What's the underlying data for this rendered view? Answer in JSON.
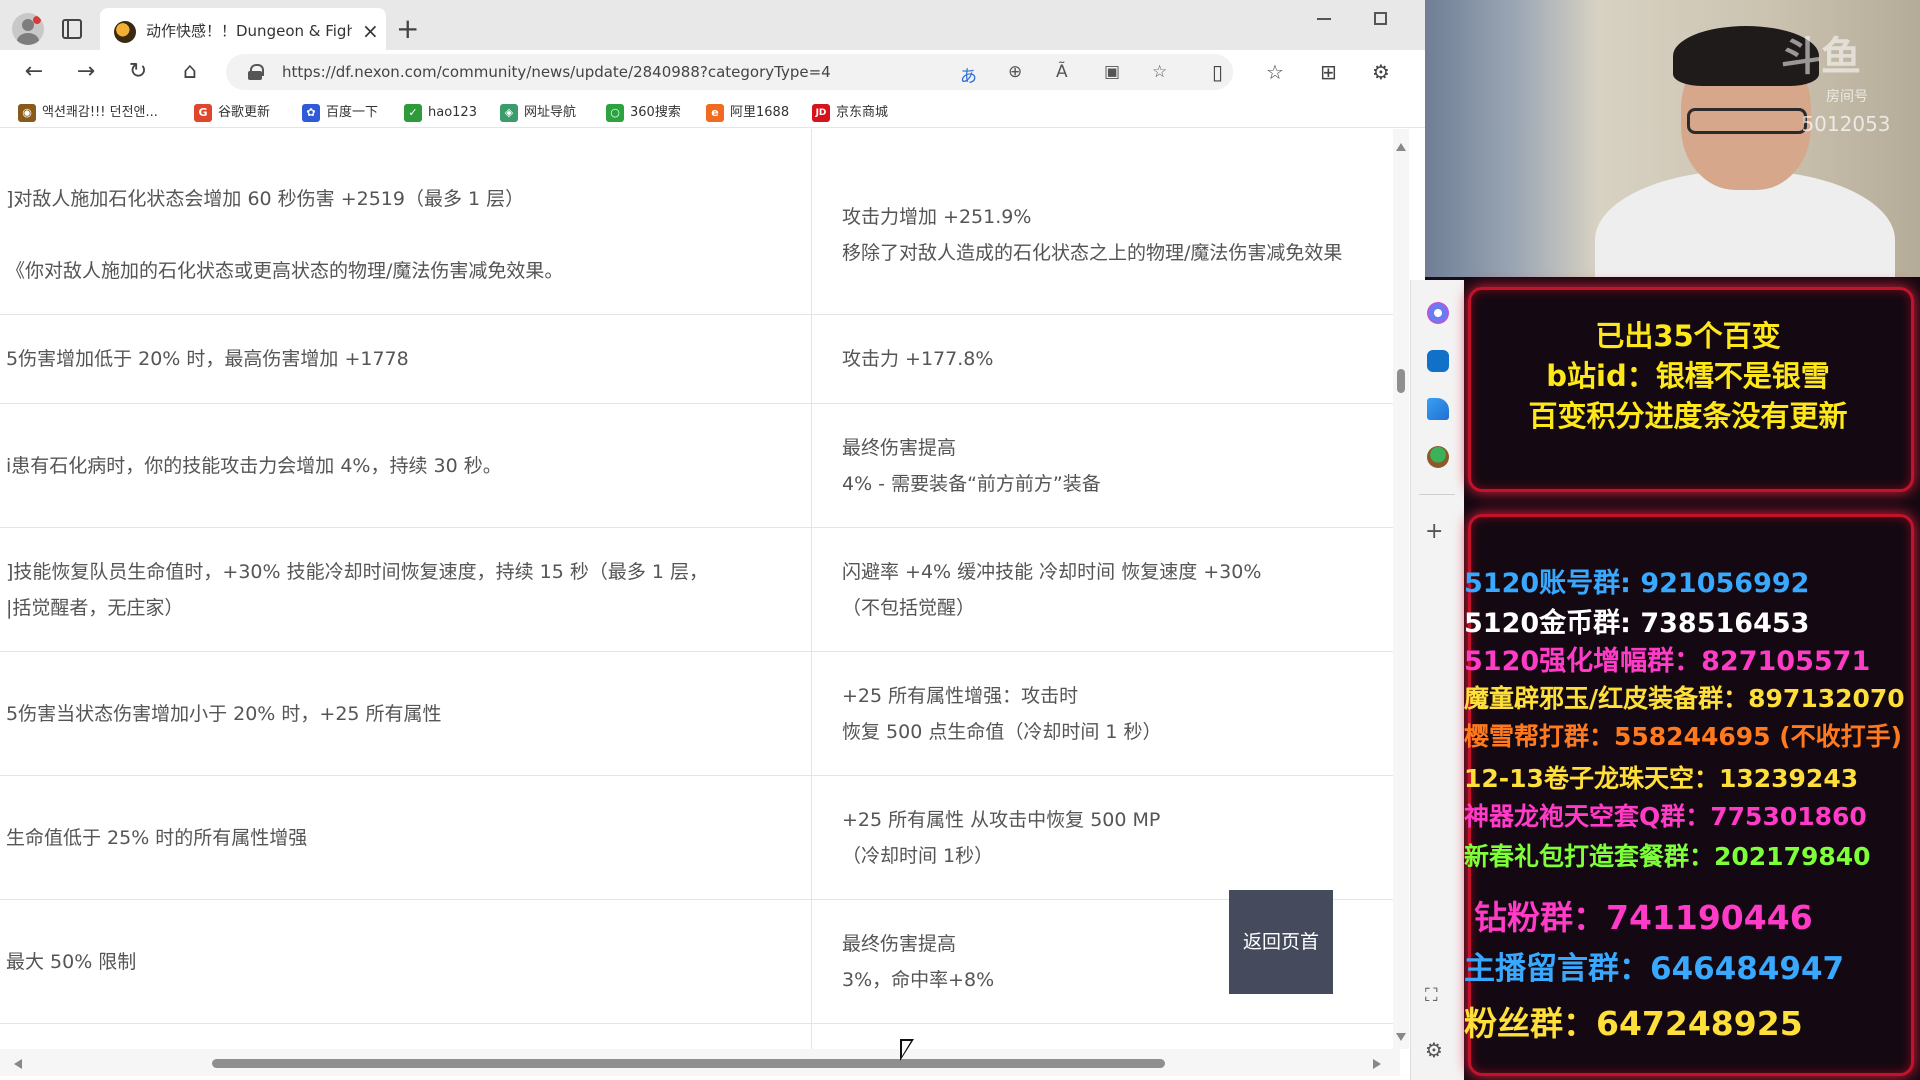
{
  "browser": {
    "tab_title": "动作快感！！Dungeon & Fighter",
    "tab_close": "×",
    "newtab": "+",
    "url": "https://df.nexon.com/community/news/update/2840988?categoryType=4",
    "nav": {
      "back": "←",
      "forward": "→",
      "reload": "↻",
      "home": "⌂"
    },
    "addr_icons": {
      "translate": "あ",
      "zoom": "⊕",
      "read_aloud": "Ã",
      "immersive": "▣",
      "favorite": "☆"
    },
    "right_icons": {
      "split": "▯",
      "favorites": "☆",
      "collections": "⊞",
      "extensions": "⚙"
    },
    "bookmarks": [
      {
        "label": "액션쾌감!!! 던전앤...",
        "icon_color": "#8a5a1a",
        "icon": "◉"
      },
      {
        "label": "谷歌更新",
        "icon_color": "#e0462c",
        "icon": "G"
      },
      {
        "label": "百度一下",
        "icon_color": "#2f5bd8",
        "icon": "✿"
      },
      {
        "label": "hao123",
        "icon_color": "#2e9b3a",
        "icon": "✓"
      },
      {
        "label": "网址导航",
        "icon_color": "#3b9b6a",
        "icon": "◈"
      },
      {
        "label": "360搜索",
        "icon_color": "#2ba33f",
        "icon": "○"
      },
      {
        "label": "阿里1688",
        "icon_color": "#f06a1f",
        "icon": "e"
      },
      {
        "label": "京东商城",
        "icon_color": "#d6131d",
        "icon": "JD"
      }
    ]
  },
  "table": {
    "rows": [
      {
        "left": [
          "]对敌人施加石化状态会增加 60 秒伤害 +2519（最多 1 层）",
          "《你对敌人施加的石化状态或更高状态的物理/魔法伤害减免效果。"
        ],
        "right": [
          "攻击力增加 +251.9%",
          "移除了对敌人造成的石化状态之上的物理/魔法伤害减免效果"
        ]
      },
      {
        "left": [
          "5伤害增加低于 20% 时，最高伤害增加 +1778"
        ],
        "right": [
          "攻击力 +177.8%"
        ]
      },
      {
        "left": [
          "i患有石化病时，你的技能攻击力会增加 4%，持续 30 秒。"
        ],
        "right": [
          "最终伤害提高",
          "4% - 需要装备“前方前方”装备"
        ]
      },
      {
        "left": [
          "]技能恢复队员生命值时，+30% 技能冷却时间恢复速度，持续 15 秒（最多 1 层，",
          "|括觉醒者，无庄家）"
        ],
        "right": [
          "闪避率 +4% 缓冲技能 冷却时间 恢复速度 +30%",
          "（不包括觉醒）"
        ]
      },
      {
        "left": [
          "5伤害当状态伤害增加小于 20% 时，+25 所有属性"
        ],
        "right": [
          "+25 所有属性增强：攻击时",
          "恢复 500 点生命值（冷却时间 1 秒）"
        ]
      },
      {
        "left": [
          "生命值低于 25% 时的所有属性增强"
        ],
        "right": [
          "+25 所有属性 从攻击中恢复 500 MP",
          "（冷却时间 1秒）"
        ]
      },
      {
        "left": [
          "最大 50% 限制"
        ],
        "right": [
          "最终伤害提高",
          "3%，命中率+8%"
        ]
      }
    ],
    "back_to_top": "返回页首"
  },
  "sidebar": {
    "add": "+",
    "screenshot": "⛶",
    "settings": "⚙"
  },
  "stream": {
    "logo": "斗鱼",
    "room_label": "房间号",
    "room_id": "5012053",
    "notice": [
      "已出35个百变",
      "b站id：银樰不是银雪",
      "百变积分进度条没有更新"
    ],
    "groups": [
      {
        "text": "5120账号群: 921056992",
        "color": "#39a9ff"
      },
      {
        "text": "5120金币群: 738516453",
        "color": "#ffffff"
      },
      {
        "text": "5120强化增幅群：827105571",
        "color": "#ff3bc8"
      },
      {
        "text": "魔童辟邪玉/红皮装备群：897132070",
        "color": "#ffe03a"
      },
      {
        "text": "樱雪帮打群：558244695 (不收打手)",
        "color": "#ff7a1e"
      },
      {
        "text": "12-13卷子龙珠天空：13239243",
        "color": "#ffe03a"
      },
      {
        "text": "神器龙袍天空套Q群：775301860",
        "color": "#ff3bc8"
      },
      {
        "text": "新春礼包打造套餐群：202179840",
        "color": "#7dff3a"
      },
      {
        "text": "钻粉群：741190446",
        "color": "#ff3bc8"
      },
      {
        "text": "主播留言群：646484947",
        "color": "#39a9ff"
      },
      {
        "text": "粉丝群：647248925",
        "color": "#ffe03a"
      }
    ],
    "notice_color": "#ffe81a"
  }
}
